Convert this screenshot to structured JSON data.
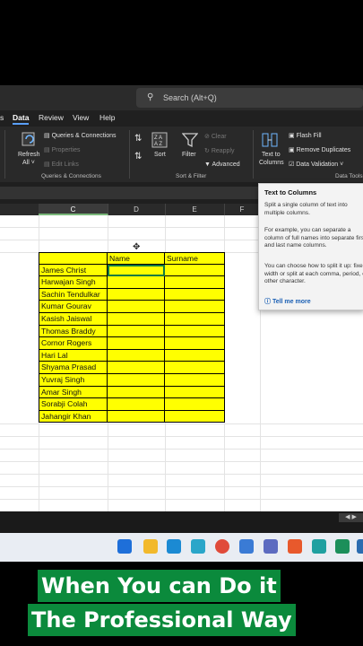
{
  "search": {
    "placeholder": "Search (Alt+Q)",
    "icon": "search-icon"
  },
  "menu": {
    "tabs": [
      "s",
      "Data",
      "Review",
      "View",
      "Help"
    ],
    "active": "Data"
  },
  "ribbon": {
    "queries": {
      "refresh_label": "Refresh",
      "refresh_sub": "All ˅",
      "items": [
        "Queries & Connections",
        "Properties",
        "Edit Links"
      ],
      "group": "Queries & Connections"
    },
    "sort_filter": {
      "sort_label": "Sort",
      "filter_label": "Filter",
      "clear": "Clear",
      "reapply": "Reapply",
      "advanced": "Advanced",
      "group": "Sort & Filter"
    },
    "data_tools": {
      "text_to_columns": "Text to",
      "text_to_columns2": "Columns",
      "flash_fill": "Flash Fill",
      "remove_duplicates": "Remove Duplicates",
      "data_validation": "Data Validation",
      "group": "Data Tools"
    }
  },
  "columns": [
    "C",
    "D",
    "E",
    "F"
  ],
  "table": {
    "headers": [
      "",
      "Name",
      "Surname"
    ],
    "rows": [
      "James Christ",
      "Harwajan Singh",
      "Sachin Tendulkar",
      "Kumar Gourav",
      "Kasish Jaiswal",
      "Thomas Braddy",
      "Cornor Rogers",
      "Hari Lal",
      "Shyama Prasad",
      "Yuvraj Singh",
      "Amar Singh",
      "Sorabji Colah",
      "Jahangir Khan"
    ]
  },
  "tooltip": {
    "title": "Text to Columns",
    "p1": "Split a single column of text into multiple columns.",
    "p2": "For example, you can separate a column of full names into separate first and last name columns.",
    "p3": "You can choose how to split it up: fixed width or split at each comma, period, or other character.",
    "more": "Tell me more"
  },
  "caption": {
    "line1": "When You can Do it",
    "line2": "The Professional Way"
  },
  "colors": {
    "highlight": "#ffff00",
    "caption_bg": "#0b8a3c",
    "accent": "#107c41"
  }
}
